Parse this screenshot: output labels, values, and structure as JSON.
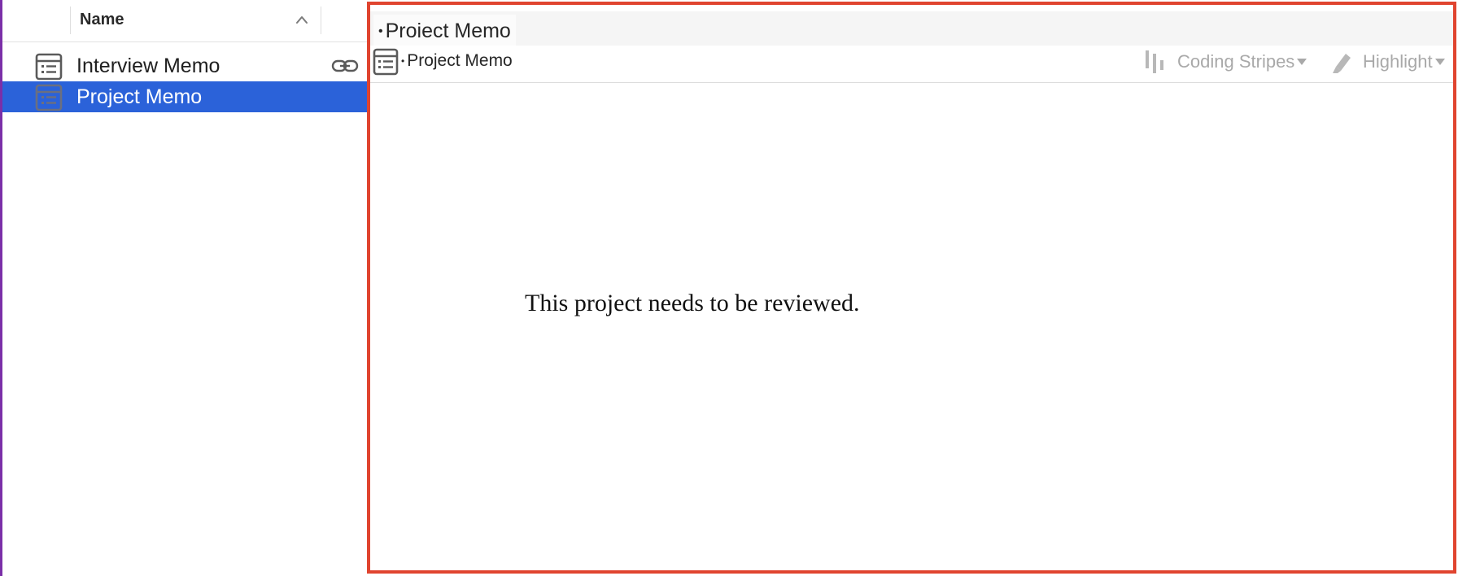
{
  "list": {
    "header": {
      "name_label": "Name",
      "sort_icon": "chevron-up-icon"
    },
    "rows": [
      {
        "label": "Interview Memo",
        "icon": "memo-document-icon",
        "linked": true,
        "link_icon": "link-icon",
        "selected": false
      },
      {
        "label": "Project Memo",
        "icon": "memo-document-icon",
        "linked": false,
        "selected": true
      }
    ],
    "selection_color": "#2b62d9"
  },
  "document": {
    "tab_title": "Proiect Memo",
    "toolbar": {
      "title": "Project Memo",
      "icon": "memo-document-icon",
      "coding_stripes_label": "Coding Stripes",
      "coding_stripes_icon": "coding-stripes-icon",
      "highlight_label": "Highlight",
      "highlight_icon": "highlighter-icon",
      "dropdown_icon": "caret-down-icon"
    },
    "body_text": "This project needs to be reviewed.",
    "focus_border_color": "#e0442f"
  }
}
